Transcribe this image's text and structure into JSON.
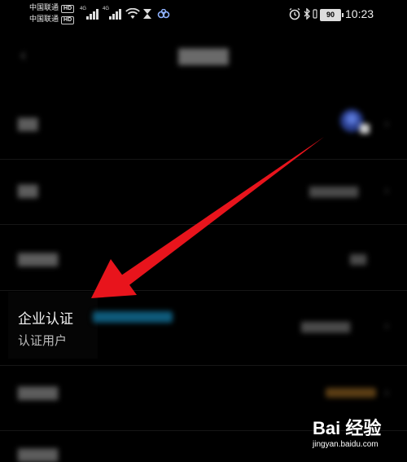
{
  "status_bar": {
    "carrier1": "中国联通",
    "carrier2": "中国联通",
    "hd": "HD",
    "net1": "4G",
    "net2": "4G",
    "battery": "90",
    "time": "10:23",
    "icons": [
      "wifi-icon",
      "hourglass-icon",
      "link-icon",
      "alarm-icon",
      "bluetooth-icon",
      "vibrate-icon"
    ]
  },
  "enterprise": {
    "title": "企业认证",
    "subtitle": "认证用户"
  },
  "watermark": {
    "brand": "Bai 经验",
    "url": "jingyan.baidu.com"
  },
  "colors": {
    "arrow": "#e8141c",
    "background": "#000000",
    "tag_blue": "#0e5a7a",
    "tag_orange": "#5a3d14"
  }
}
